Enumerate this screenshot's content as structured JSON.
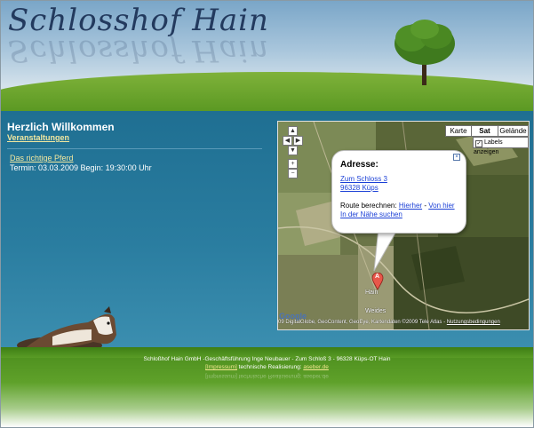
{
  "header": {
    "site_title": "Schlosshof Hain"
  },
  "content": {
    "welcome": "Herzlich Willkommen",
    "events_link": "Veranstaltungen",
    "event": {
      "title": "Das richtige Pferd",
      "info": "Termin: 03.03.2009 Begin: 19:30:00 Uhr"
    }
  },
  "map": {
    "types": [
      "Karte",
      "Sat",
      "Gelände"
    ],
    "active_type": "Sat",
    "labels_option": "Labels anzeigen",
    "labels_checked_glyph": "✓",
    "nav_glyphs": {
      "up": "▲",
      "left": "◀",
      "right": "▶",
      "down": "▼",
      "zoom_in": "+",
      "zoom_out": "−"
    },
    "info_window": {
      "close_glyph": "×",
      "title": "Adresse:",
      "street": "Zum Schloss 3",
      "city": "96328 Küps",
      "route_label": "Route berechnen:",
      "route_to": "Hierher",
      "route_sep": "-",
      "route_from": "Von hier",
      "nearby": "In der Nähe suchen"
    },
    "marker_letter": "A",
    "places": {
      "hain": "Hain",
      "weides": "Weides"
    },
    "google_logo": "Google",
    "copyright": "09 DigitalGlobe, GeoContent, GeoEye, Kartendaten ©2009 Tele Atlas - ",
    "terms": "Nutzungsbedingungen"
  },
  "footer": {
    "line1": "Schloßhof Hain GmbH -Geschäftsführung Inge Neubauer - Zum Schloß 3 - 96328 Küps-OT Hain",
    "impressum": "[Impressum]",
    "line2_middle": " technische Realisierung: ",
    "realisation_link": "aseber.de",
    "reflection": "[Impressum] technische Realisierung: aseber.de"
  },
  "colors": {
    "sky": "#7aa6c8",
    "content_blue": "#1f6f92",
    "link_yellow": "#f2e8a0",
    "grass": "#5d9a24"
  }
}
